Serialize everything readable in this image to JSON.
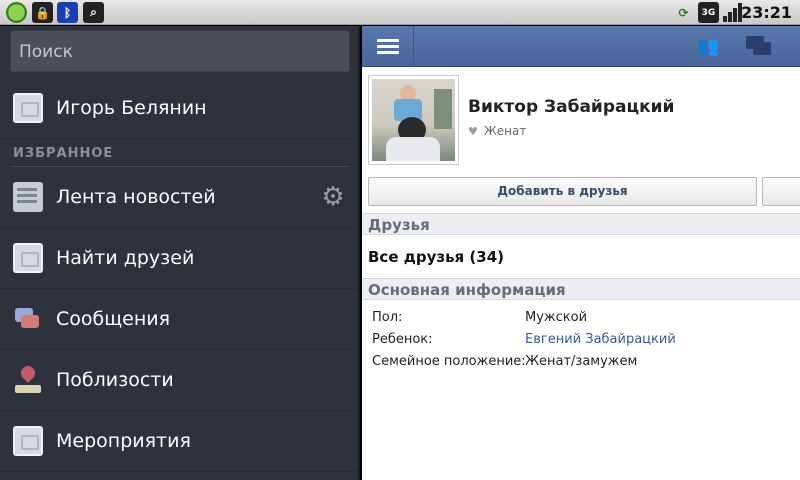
{
  "status_bar": {
    "time": "23:21",
    "left_icons": [
      "app-icon",
      "lock-icon",
      "bluetooth-icon",
      "search-icon"
    ],
    "right_icons": [
      "sync-icon",
      "3g-icon",
      "signal-icon"
    ]
  },
  "sidebar": {
    "search_placeholder": "Поиск",
    "user_name": "Игорь Белянин",
    "section_title": "ИЗБРАННОЕ",
    "items": [
      {
        "label": "Лента новостей",
        "icon": "news-feed-icon",
        "has_settings": true
      },
      {
        "label": "Найти друзей",
        "icon": "find-friends-icon"
      },
      {
        "label": "Сообщения",
        "icon": "messages-icon"
      },
      {
        "label": "Поблизости",
        "icon": "nearby-icon"
      },
      {
        "label": "Мероприятия",
        "icon": "events-icon"
      }
    ]
  },
  "profile": {
    "name": "Виктор Забайрацкий",
    "relationship": "Женат",
    "add_friend_button": "Добавить в друзья"
  },
  "friends": {
    "section_title": "Друзья",
    "all_friends": "Все друзья (34)"
  },
  "info": {
    "section_title": "Основная информация",
    "rows": [
      {
        "label": "Пол:",
        "value": "Мужской"
      },
      {
        "label": "Ребенок:",
        "value": "Евгений Забайрацкий"
      },
      {
        "label": "Семейное положение:",
        "value": "Женат/замужем"
      }
    ]
  },
  "colors": {
    "sidebar_bg": "#2d323d",
    "topbar_bg": "#4a6599",
    "link": "#3b5998"
  }
}
